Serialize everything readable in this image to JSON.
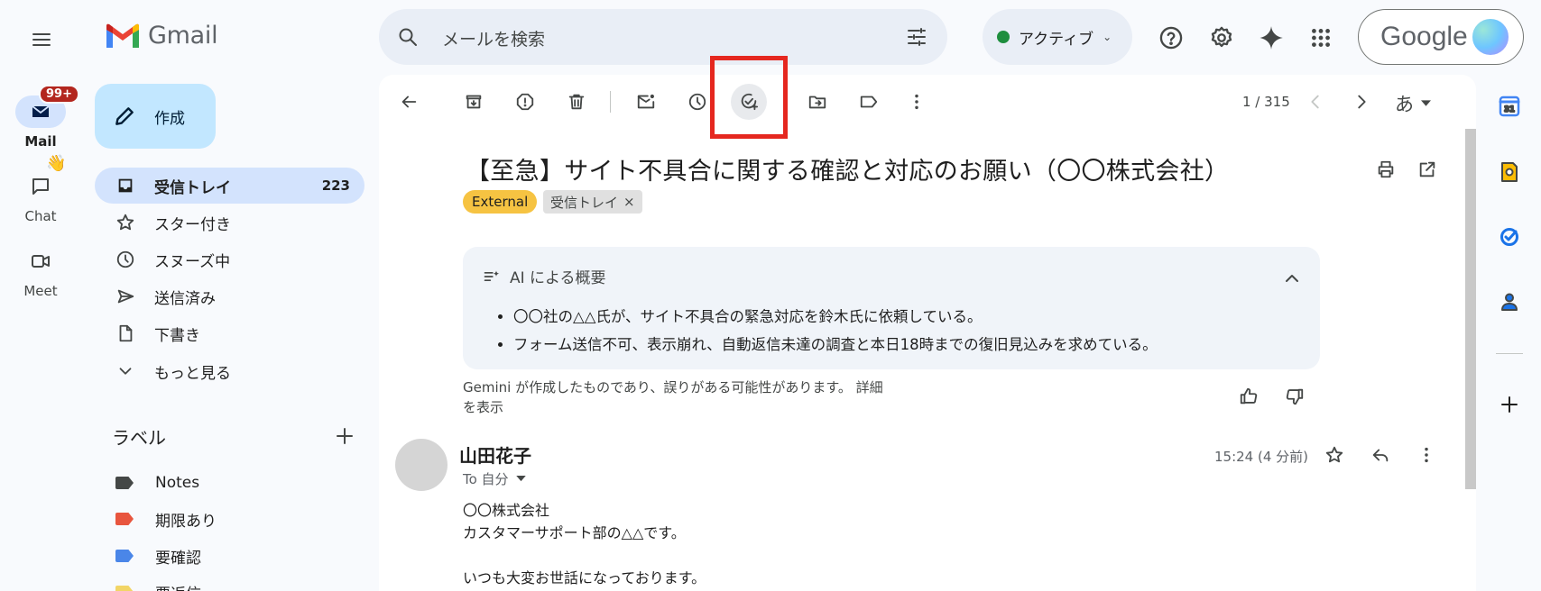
{
  "app": {
    "name": "Gmail"
  },
  "search": {
    "placeholder": "メールを検索"
  },
  "status": {
    "label": "アクティブ"
  },
  "account": {
    "brand": "Google"
  },
  "rail": {
    "mail": {
      "label": "Mail",
      "badge": "99+"
    },
    "chat": {
      "label": "Chat",
      "emoji": "👋"
    },
    "meet": {
      "label": "Meet"
    }
  },
  "compose": {
    "label": "作成"
  },
  "nav": {
    "items": [
      {
        "label": "受信トレイ",
        "count": "223",
        "icon": "inbox-icon",
        "active": true
      },
      {
        "label": "スター付き",
        "icon": "star-icon"
      },
      {
        "label": "スヌーズ中",
        "icon": "clock-icon"
      },
      {
        "label": "送信済み",
        "icon": "send-icon"
      },
      {
        "label": "下書き",
        "icon": "draft-icon"
      },
      {
        "label": "もっと見る",
        "icon": "chevron-down-icon"
      }
    ]
  },
  "labels": {
    "heading": "ラベル",
    "items": [
      {
        "label": "Notes",
        "color": "#444746"
      },
      {
        "label": "期限あり",
        "color": "#e8553e"
      },
      {
        "label": "要確認",
        "color": "#4a86e8"
      },
      {
        "label": "要返信",
        "color": "#f2d566"
      }
    ]
  },
  "toolbar": {
    "pager": "1 / 315",
    "input_tool": "あ"
  },
  "email": {
    "subject": "【至急】サイト不具合に関する確認と対応のお願い（〇〇株式会社）",
    "chips": {
      "external": "External",
      "inbox": "受信トレイ",
      "inbox_close": "×"
    },
    "ai_summary": {
      "heading": "AI による概要",
      "points": [
        "〇〇社の△△氏が、サイト不具合の緊急対応を鈴木氏に依頼している。",
        "フォーム送信不可、表示崩れ、自動返信未達の調査と本日18時までの復旧見込みを求めている。"
      ]
    },
    "disclaimer": "Gemini が作成したものであり、誤りがある可能性があります。 詳細を表示",
    "sender": "山田花子",
    "to": "To 自分",
    "time": "15:24 (4 分前)",
    "body": [
      "〇〇株式会社",
      "カスタマーサポート部の△△です。",
      "",
      "いつも大変お世話になっております。"
    ]
  },
  "side_panel": {
    "calendar_day": "31"
  }
}
